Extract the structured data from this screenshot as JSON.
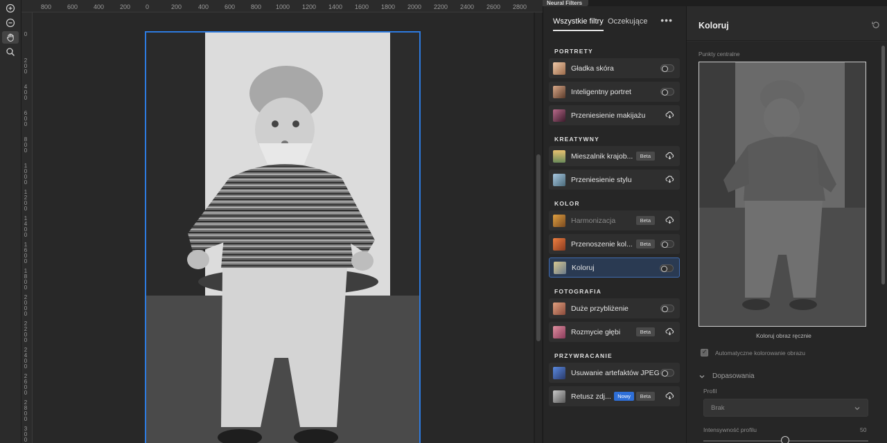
{
  "rulers": {
    "horizontal": [
      "800",
      "600",
      "400",
      "200",
      "0",
      "200",
      "400",
      "600",
      "800",
      "1000",
      "1200",
      "1400",
      "1600",
      "1800",
      "2000",
      "2200",
      "2400",
      "2600",
      "2800"
    ],
    "vertical": [
      "0",
      "200",
      "400",
      "600",
      "800",
      "1000",
      "1200",
      "1400",
      "1600",
      "1800",
      "2000",
      "2200",
      "2400",
      "2600",
      "2800",
      "3000"
    ]
  },
  "tools": [
    {
      "name": "zoom-in-icon"
    },
    {
      "name": "zoom-out-icon"
    },
    {
      "name": "hand-icon"
    },
    {
      "name": "search-icon"
    }
  ],
  "neural_filters": {
    "panel_tab": "Neural Filters",
    "tabs": [
      "Wszystkie filtry",
      "Oczekujące"
    ],
    "more": "•••",
    "sections": [
      {
        "label": "PORTRETY",
        "items": [
          {
            "label": "Gładka skóra",
            "control": "toggle"
          },
          {
            "label": "Inteligentny portret",
            "control": "toggle"
          },
          {
            "label": "Przeniesienie makijażu",
            "control": "cloud"
          }
        ]
      },
      {
        "label": "KREATYWNY",
        "items": [
          {
            "label": "Mieszalnik krajob...",
            "badge": "Beta",
            "control": "cloud"
          },
          {
            "label": "Przeniesienie stylu",
            "control": "cloud"
          }
        ]
      },
      {
        "label": "KOLOR",
        "items": [
          {
            "label": "Harmonizacja",
            "badge": "Beta",
            "control": "cloud"
          },
          {
            "label": "Przenoszenie kol...",
            "badge": "Beta",
            "control": "toggle"
          },
          {
            "label": "Koloruj",
            "control": "toggle",
            "selected": true
          }
        ]
      },
      {
        "label": "FOTOGRAFIA",
        "items": [
          {
            "label": "Duże przybliżenie",
            "control": "toggle"
          },
          {
            "label": "Rozmycie głębi",
            "badge": "Beta",
            "control": "cloud"
          }
        ]
      },
      {
        "label": "PRZYWRACANIE",
        "items": [
          {
            "label": "Usuwanie artefaktów JPEG",
            "control": "toggle"
          },
          {
            "label": "Retusz zdj...",
            "badge_new": "Nowy",
            "badge": "Beta",
            "control": "cloud"
          }
        ]
      }
    ]
  },
  "properties": {
    "title": "Koloruj",
    "focal_points_label": "Punkty centralne",
    "preview_caption": "Koloruj obraz ręcznie",
    "auto_color_label": "Automatyczne kolorowanie obrazu",
    "auto_color_checked": true,
    "adjustments_label": "Dopasowania",
    "profile_label": "Profil",
    "profile_value": "Brak",
    "intensity_label": "Intensywność profilu",
    "intensity_value": "50"
  },
  "colors": {
    "accent": "#2d7be0",
    "selected_bg": "#2a3a52",
    "new_badge": "#2e6fd8"
  }
}
